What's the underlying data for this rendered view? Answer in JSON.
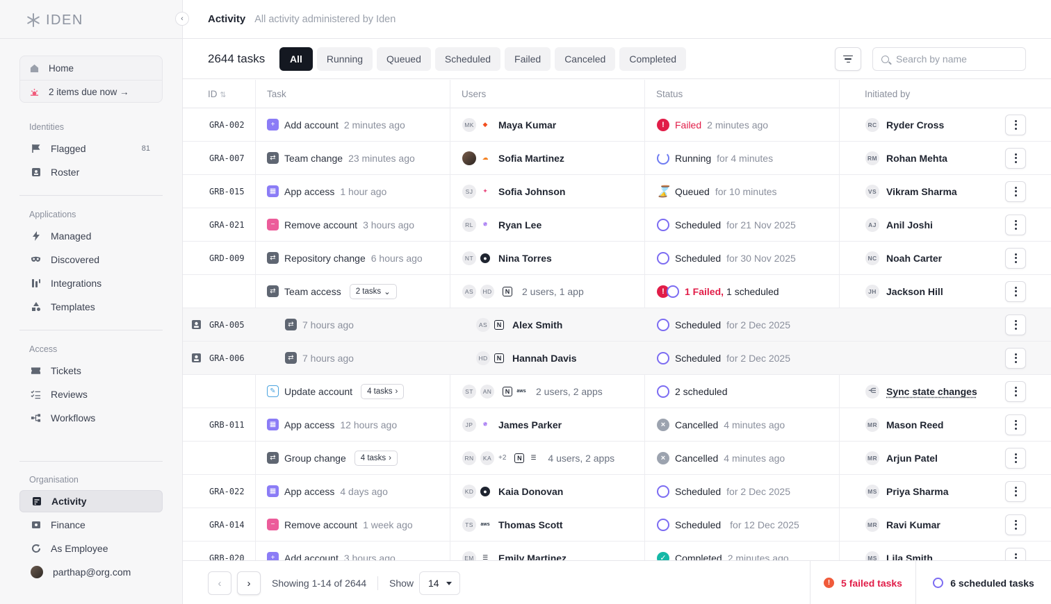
{
  "app": {
    "brand": "IDEN"
  },
  "header": {
    "title": "Activity",
    "subtitle": "All activity administered by Iden"
  },
  "sidebar": {
    "home_label": "Home",
    "due_label": "2 items due now →",
    "sections": [
      {
        "label": "Identities",
        "items": [
          {
            "label": "Flagged",
            "count": "81",
            "icon": "flag-icon"
          },
          {
            "label": "Roster",
            "icon": "roster-icon"
          }
        ]
      },
      {
        "label": "Applications",
        "items": [
          {
            "label": "Managed",
            "icon": "bolt-icon"
          },
          {
            "label": "Discovered",
            "icon": "mask-icon"
          },
          {
            "label": "Integrations",
            "icon": "integrations-icon"
          },
          {
            "label": "Templates",
            "icon": "shapes-icon"
          }
        ]
      },
      {
        "label": "Access",
        "items": [
          {
            "label": "Tickets",
            "icon": "ticket-icon"
          },
          {
            "label": "Reviews",
            "icon": "checklist-icon"
          },
          {
            "label": "Workflows",
            "icon": "workflow-icon"
          }
        ]
      },
      {
        "label": "Organisation",
        "items": [
          {
            "label": "Activity",
            "icon": "activity-icon",
            "active": true
          },
          {
            "label": "Finance",
            "icon": "finance-icon"
          },
          {
            "label": "As Employee",
            "icon": "refresh-icon"
          },
          {
            "label": "parthap@org.com",
            "icon": "user-avatar"
          }
        ]
      }
    ]
  },
  "toolbar": {
    "task_count": "2644 tasks",
    "tabs": [
      "All",
      "Running",
      "Queued",
      "Scheduled",
      "Failed",
      "Canceled",
      "Completed"
    ],
    "active_tab": "All",
    "search_placeholder": "Search by name"
  },
  "table": {
    "columns": [
      "ID",
      "Task",
      "Users",
      "Status",
      "Initiated by"
    ],
    "rows": [
      {
        "id": "GRA-002",
        "task": "Add account",
        "task_time": "2 minutes ago",
        "task_icon": "add-account-icon",
        "users": [
          "MK"
        ],
        "user_name": "Maya Kumar",
        "app": "figma-icon",
        "status": "Failed",
        "status_detail": "2 minutes ago",
        "status_kind": "failed",
        "init": "Ryder Cross",
        "init_initials": "RC"
      },
      {
        "id": "GRA-007",
        "task": "Team change",
        "task_time": "23 minutes ago",
        "task_icon": "change-icon",
        "users": [
          "photo"
        ],
        "user_name": "Sofia Martinez",
        "app": "cloud-icon",
        "status": "Running",
        "status_detail": "for 4 minutes",
        "status_kind": "running",
        "init": "Rohan Mehta",
        "init_initials": "RM"
      },
      {
        "id": "GRB-015",
        "task": "App access",
        "task_time": "1 hour ago",
        "task_icon": "app-access-icon",
        "users": [
          "SJ"
        ],
        "user_name": "Sofia Johnson",
        "app": "tableau-icon",
        "status": "Queued",
        "status_detail": "for 10 minutes",
        "status_kind": "queued",
        "init": "Vikram Sharma",
        "init_initials": "VS"
      },
      {
        "id": "GRA-021",
        "task": "Remove account",
        "task_time": "3 hours ago",
        "task_icon": "remove-account-icon",
        "users": [
          "RL"
        ],
        "user_name": "Ryan Lee",
        "app": "sparkle-icon",
        "status": "Scheduled",
        "status_detail": "for 21 Nov 2025",
        "status_kind": "scheduled",
        "init": "Anil Joshi",
        "init_initials": "AJ"
      },
      {
        "id": "GRD-009",
        "task": "Repository change",
        "task_time": "6 hours ago",
        "task_icon": "change-icon",
        "users": [
          "NT"
        ],
        "user_name": "Nina Torres",
        "app": "github-icon",
        "status": "Scheduled",
        "status_detail": "for 30 Nov 2025",
        "status_kind": "scheduled",
        "init": "Noah Carter",
        "init_initials": "NC"
      },
      {
        "id": "",
        "task": "Team access",
        "task_pill": "2 tasks",
        "pill_dir": "⌄",
        "task_icon": "change-icon",
        "users": [
          "AS",
          "HD"
        ],
        "user_count": "2 users, 1 app",
        "app": "notion-icon",
        "status_fail": "1 Failed,",
        "status_sched": "1 scheduled",
        "status_kind": "mixed",
        "init": "Jackson Hill",
        "init_initials": "JH"
      },
      {
        "id": "GRA-005",
        "child": true,
        "task_time": "7 hours ago",
        "task_icon": "change-icon",
        "users": [
          "AS"
        ],
        "user_name": "Alex Smith",
        "app": "notion-icon",
        "status": "Scheduled",
        "status_detail": "for 2 Dec 2025",
        "status_kind": "scheduled"
      },
      {
        "id": "GRA-006",
        "child": true,
        "task_time": "7 hours ago",
        "task_icon": "change-icon",
        "users": [
          "HD"
        ],
        "user_name": "Hannah Davis",
        "app": "notion-icon",
        "status": "Scheduled",
        "status_detail": "for 2 Dec 2025",
        "status_kind": "scheduled"
      },
      {
        "id": "",
        "task": "Update account",
        "task_pill": "4 tasks",
        "pill_dir": "›",
        "task_icon": "update-account-icon",
        "users": [
          "ST",
          "AN"
        ],
        "user_count": "2 users, 2 apps",
        "app": "notion-icon",
        "app2": "aws",
        "status": "2 scheduled",
        "status_kind": "scheduled-plain",
        "init": "Sync state changes",
        "init_icon": "sync-icon"
      },
      {
        "id": "GRB-011",
        "task": "App access",
        "task_time": "12 hours ago",
        "task_icon": "app-access-icon",
        "users": [
          "JP"
        ],
        "user_name": "James Parker",
        "app": "sparkle-icon",
        "status": "Cancelled",
        "status_detail": "4 minutes ago",
        "status_kind": "cancelled",
        "init": "Mason Reed",
        "init_initials": "MR"
      },
      {
        "id": "",
        "task": "Group change",
        "task_pill": "4 tasks",
        "pill_dir": "›",
        "task_icon": "change-icon",
        "users": [
          "RN",
          "KA"
        ],
        "extra_users": "+2",
        "user_count": "4 users, 2 apps",
        "app": "notion-icon",
        "app2": "stack",
        "status": "Cancelled",
        "status_detail": "4 minutes ago",
        "status_kind": "cancelled",
        "init": "Arjun Patel",
        "init_initials": "MR"
      },
      {
        "id": "GRA-022",
        "task": "App access",
        "task_time": "4 days ago",
        "task_icon": "app-access-icon",
        "users": [
          "KD"
        ],
        "user_name": "Kaia Donovan",
        "app": "github-icon",
        "status": "Scheduled",
        "status_detail": "for 2 Dec 2025",
        "status_kind": "scheduled",
        "init": "Priya Sharma",
        "init_initials": "MS"
      },
      {
        "id": "GRA-014",
        "task": "Remove account",
        "task_time": "1 week ago",
        "task_icon": "remove-account-icon",
        "users": [
          "TS"
        ],
        "user_name": "Thomas Scott",
        "app": "aws",
        "status": "Scheduled",
        "status_detail": "for 12 Dec 2025",
        "status_kind": "scheduled",
        "init": "Ravi Kumar",
        "init_initials": "MR"
      },
      {
        "id": "GRB-020",
        "task": "Add account",
        "task_time": "3 hours ago",
        "task_icon": "add-account-icon",
        "users": [
          "EM"
        ],
        "user_name": "Emily Martinez",
        "app": "stack",
        "status": "Completed",
        "status_detail": "2 minutes ago",
        "status_kind": "completed",
        "init": "Lila Smith",
        "init_initials": "MS"
      }
    ]
  },
  "footer": {
    "showing": "Showing 1-14 of 2644",
    "show_label": "Show",
    "page_size": "14",
    "failed": "5 failed tasks",
    "scheduled": "6 scheduled tasks"
  },
  "colors": {
    "accent": "#141821",
    "failed": "#e11d48",
    "scheduled": "#7c6cf2",
    "completed": "#14b8a6"
  }
}
